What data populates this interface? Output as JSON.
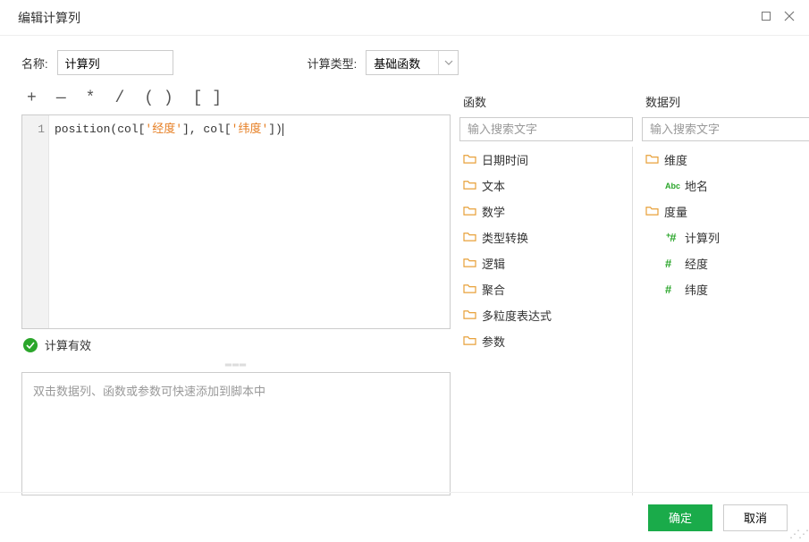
{
  "titlebar": {
    "title": "编辑计算列"
  },
  "form": {
    "name_label": "名称:",
    "name_value": "计算列",
    "type_label": "计算类型:",
    "type_value": "基础函数"
  },
  "toolbar": {
    "plus": "+",
    "minus": "—",
    "star": "*",
    "slash": "/",
    "parens": "( )",
    "brackets": "[ ]"
  },
  "editor": {
    "line_no": "1",
    "seg1": "position(col[",
    "str1": "'经度'",
    "seg2": "], col[",
    "str2": "'纬度'",
    "seg3": "])"
  },
  "status": {
    "text": "计算有效"
  },
  "hint": {
    "text": "双击数据列、函数或参数可快速添加到脚本中"
  },
  "functions": {
    "header": "函数",
    "search_placeholder": "输入搜索文字",
    "items": [
      "日期时间",
      "文本",
      "数学",
      "类型转换",
      "逻辑",
      "聚合",
      "多粒度表达式",
      "参数"
    ]
  },
  "datacols": {
    "header": "数据列",
    "search_placeholder": "输入搜索文字",
    "dim_label": "维度",
    "place_label": "地名",
    "measure_label": "度量",
    "calc_label": "计算列",
    "lng_label": "经度",
    "lat_label": "纬度"
  },
  "footer": {
    "ok": "确定",
    "cancel": "取消"
  }
}
